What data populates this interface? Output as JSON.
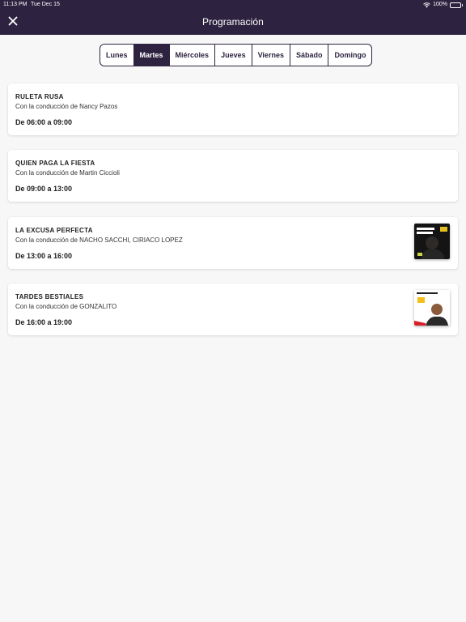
{
  "status_bar": {
    "time": "11:13 PM",
    "date": "Tue Dec 15",
    "battery": "100%"
  },
  "nav": {
    "title": "Programación",
    "close_icon": "close-icon"
  },
  "days": [
    "Lunes",
    "Martes",
    "Miércoles",
    "Jueves",
    "Viernes",
    "Sábado",
    "Domingo"
  ],
  "selected_day": "Martes",
  "programs": [
    {
      "title": "RULETA RUSA",
      "host": "Con la conducción de Nancy Pazos",
      "time": "De 06:00 a 09:00",
      "thumbnail": null
    },
    {
      "title": "QUIEN PAGA LA FIESTA",
      "host": "Con la conducción de Martin Ciccioli",
      "time": "De 09:00 a 13:00",
      "thumbnail": null
    },
    {
      "title": "LA EXCUSA PERFECTA",
      "host": "Con la conducción de NACHO SACCHI, CIRIACO LOPEZ",
      "time": "De 13:00 a 16:00",
      "thumbnail": "la-excusa-perfecta-thumbnail"
    },
    {
      "title": "TARDES BESTIALES",
      "host": "Con la conducción de GONZALITO",
      "time": "De 16:00 a 19:00",
      "thumbnail": "tardes-bestiales-thumbnail"
    }
  ],
  "colors": {
    "header": "#2d2340",
    "background": "#f7f7f7",
    "card": "#ffffff"
  }
}
